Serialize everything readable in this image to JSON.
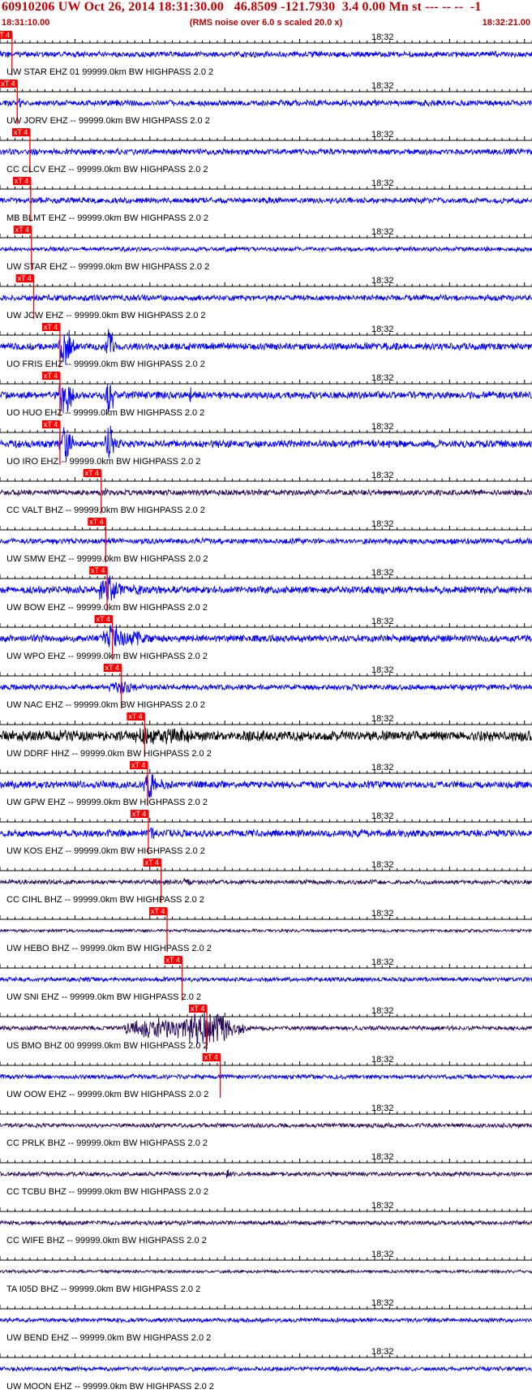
{
  "header": {
    "title": "60910206 UW Oct 26, 2014 18:31:30.00   46.8509 -121.7930  3.4 0.00 Mn st --- -- --  -1",
    "subtitle": "(RMS noise over 6.0 s scaled 20.0 x)",
    "time_start": "18:31:10.00",
    "time_end": "18:32:21.00"
  },
  "chart_data": {
    "type": "line",
    "title": "60910206 UW Oct 26, 2014 18:31:30.00   46.8509 -121.7930  3.4 0.00 Mn st --- -- --  -1",
    "subtitle": "(RMS noise over 6.0 s scaled 20.0 x)",
    "x_start": "18:31:10.00",
    "x_end": "18:32:21.00",
    "x_tick_label": "18:32",
    "pick_label": "xT 4",
    "colors": {
      "waveform_default": "#0000ff",
      "waveform_bhz": "#2a0a5c",
      "waveform_hhz": "#000000",
      "pick": "#ff0000",
      "text": "#c00000"
    },
    "series": [
      {
        "name": "UW STAR EHZ 01 99999.0km BW  HIGHPASS  2.0  2",
        "color": "#0000ff",
        "pick_s": 1.6,
        "amp": 4,
        "events": [
          [
            25.7,
            0.3,
            4
          ],
          [
            33.2,
            0.5,
            3
          ]
        ]
      },
      {
        "name": "UW JORV EHZ -- 99999.0km BW  HIGHPASS  2.0  2",
        "color": "#0000ff",
        "pick_s": 2.3,
        "amp": 4,
        "events": [
          [
            2.5,
            1.2,
            8
          ],
          [
            57,
            3,
            7
          ]
        ]
      },
      {
        "name": "CC CLCV EHZ -- 99999.0km BW  HIGHPASS  2.0  2",
        "color": "#0000ff",
        "pick_s": 4.0,
        "amp": 4,
        "events": [
          [
            4.5,
            1.2,
            5
          ],
          [
            20.5,
            1.5,
            5
          ],
          [
            23.5,
            2,
            4
          ],
          [
            44,
            4,
            4
          ]
        ]
      },
      {
        "name": "MB BLMT EHZ -- 99999.0km BW  HIGHPASS  2.0  2",
        "color": "#0000ff",
        "pick_s": 4.1,
        "amp": 4,
        "events": [
          [
            8,
            6,
            4
          ]
        ]
      },
      {
        "name": "UW STAR EHZ -- 99999.0km BW  HIGHPASS  2.0  2",
        "color": "#0000ff",
        "pick_s": 4.2,
        "amp": 3,
        "events": []
      },
      {
        "name": "UW JCW EHZ -- 99999.0km BW  HIGHPASS  2.0  2",
        "color": "#0000ff",
        "pick_s": 4.5,
        "amp": 4,
        "events": []
      },
      {
        "name": "UO FRIS EHZ -- 99999.0km BW  HIGHPASS  2.0  2",
        "color": "#0000ff",
        "pick_s": 8.0,
        "amp": 5,
        "events": [
          [
            8.6,
            1.8,
            28
          ],
          [
            14.5,
            1.2,
            28
          ]
        ]
      },
      {
        "name": "UO HUO EHZ -- 99999.0km BW  HIGHPASS  2.0  2",
        "color": "#0000ff",
        "pick_s": 8.0,
        "amp": 5,
        "events": [
          [
            8.6,
            1.8,
            28
          ],
          [
            14.5,
            1.2,
            28
          ],
          [
            25.4,
            0.2,
            15
          ]
        ]
      },
      {
        "name": "UO IRO EHZ -- 99999.0km BW  HIGHPASS  2.0  2",
        "color": "#0000ff",
        "pick_s": 8.0,
        "amp": 5,
        "events": [
          [
            8.6,
            1.8,
            28
          ],
          [
            14.5,
            1.2,
            28
          ],
          [
            26.8,
            0.4,
            12
          ]
        ]
      },
      {
        "name": "CC VALT BHZ -- 99999.0km BW  HIGHPASS  2.0  2",
        "color": "#2a0a5c",
        "pick_s": 13.5,
        "amp": 4,
        "events": [
          [
            13.8,
            1.5,
            7
          ]
        ]
      },
      {
        "name": "UW SMW EHZ -- 99999.0km BW  HIGHPASS  2.0  2",
        "color": "#0000ff",
        "pick_s": 14.1,
        "amp": 4,
        "events": [
          [
            14.3,
            1,
            6
          ],
          [
            16,
            3,
            5
          ]
        ]
      },
      {
        "name": "UW BOW EHZ -- 99999.0km BW  HIGHPASS  2.0  2",
        "color": "#0000ff",
        "pick_s": 14.3,
        "amp": 5,
        "events": [
          [
            14.5,
            3,
            20
          ],
          [
            18,
            3,
            8
          ]
        ]
      },
      {
        "name": "UW WPO EHZ -- 99999.0km BW  HIGHPASS  2.0  2",
        "color": "#0000ff",
        "pick_s": 15.0,
        "amp": 5,
        "events": [
          [
            15,
            3,
            20
          ],
          [
            18,
            3,
            12
          ]
        ]
      },
      {
        "name": "UW NAC EHZ -- 99999.0km BW  HIGHPASS  2.0  2",
        "color": "#0000ff",
        "pick_s": 16.2,
        "amp": 4,
        "events": [
          [
            16.2,
            4,
            9
          ]
        ]
      },
      {
        "name": "UW DDRF HHZ -- 99999.0km BW  HIGHPASS  2.0  2",
        "color": "#000000",
        "pick_s": 19.3,
        "amp": 7,
        "events": [
          [
            10,
            12,
            9
          ],
          [
            18.8,
            3,
            18
          ],
          [
            22,
            10,
            12
          ]
        ]
      },
      {
        "name": "UW GPW EHZ -- 99999.0km BW  HIGHPASS  2.0  2",
        "color": "#0000ff",
        "pick_s": 19.7,
        "amp": 5,
        "events": [
          [
            19.8,
            1.5,
            20
          ],
          [
            21.5,
            3,
            8
          ]
        ]
      },
      {
        "name": "UW KOS EHZ -- 99999.0km BW  HIGHPASS  2.0  2",
        "color": "#0000ff",
        "pick_s": 19.8,
        "amp": 5,
        "events": [
          [
            20.2,
            1.5,
            10
          ]
        ]
      },
      {
        "name": "CC CIHL BHZ -- 99999.0km BW  HIGHPASS  2.0  2",
        "color": "#2a0a5c",
        "pick_s": 21.5,
        "amp": 3,
        "events": [
          [
            21.5,
            3,
            5
          ],
          [
            25,
            1.5,
            6
          ]
        ]
      },
      {
        "name": "UW HEBO BHZ -- 99999.0km BW  HIGHPASS  2.0  2",
        "color": "#2a0a5c",
        "pick_s": 22.3,
        "amp": 2,
        "events": []
      },
      {
        "name": "UW SNI EHZ -- 99999.0km BW  HIGHPASS  2.0  2",
        "color": "#0000ff",
        "pick_s": 24.3,
        "amp": 3,
        "events": []
      },
      {
        "name": "US BMO BHZ 00 99999.0km BW  HIGHPASS  2.0  2",
        "color": "#2a0a5c",
        "pick_s": 27.6,
        "amp": 3,
        "events": [
          [
            18,
            4,
            10
          ],
          [
            22,
            10,
            16
          ],
          [
            27.5,
            6,
            30
          ]
        ]
      },
      {
        "name": "UW OOW EHZ -- 99999.0km BW  HIGHPASS  2.0  2",
        "color": "#0000ff",
        "pick_s": 29.4,
        "amp": 3,
        "events": []
      },
      {
        "name": "CC PRLK BHZ -- 99999.0km BW  HIGHPASS  2.0  2",
        "color": "#2a0a5c",
        "pick_s": null,
        "amp": 3,
        "events": []
      },
      {
        "name": "CC TCBU BHZ -- 99999.0km BW  HIGHPASS  2.0  2",
        "color": "#2a0a5c",
        "pick_s": null,
        "amp": 3,
        "events": [
          [
            30.3,
            0.5,
            8
          ]
        ]
      },
      {
        "name": "CC WIFE BHZ -- 99999.0km BW  HIGHPASS  2.0  2",
        "color": "#2a0a5c",
        "pick_s": null,
        "amp": 3,
        "events": []
      },
      {
        "name": "TA I05D BHZ -- 99999.0km BW  HIGHPASS  2.0  2",
        "color": "#2a0a5c",
        "pick_s": null,
        "amp": 2,
        "events": []
      },
      {
        "name": "UW BEND EHZ -- 99999.0km BW  HIGHPASS  2.0  2",
        "color": "#0000ff",
        "pick_s": null,
        "amp": 3,
        "events": []
      },
      {
        "name": "UW MOON EHZ -- 99999.0km BW  HIGHPASS  2.0  2",
        "color": "#0000ff",
        "pick_s": null,
        "amp": 3,
        "events": []
      }
    ]
  }
}
